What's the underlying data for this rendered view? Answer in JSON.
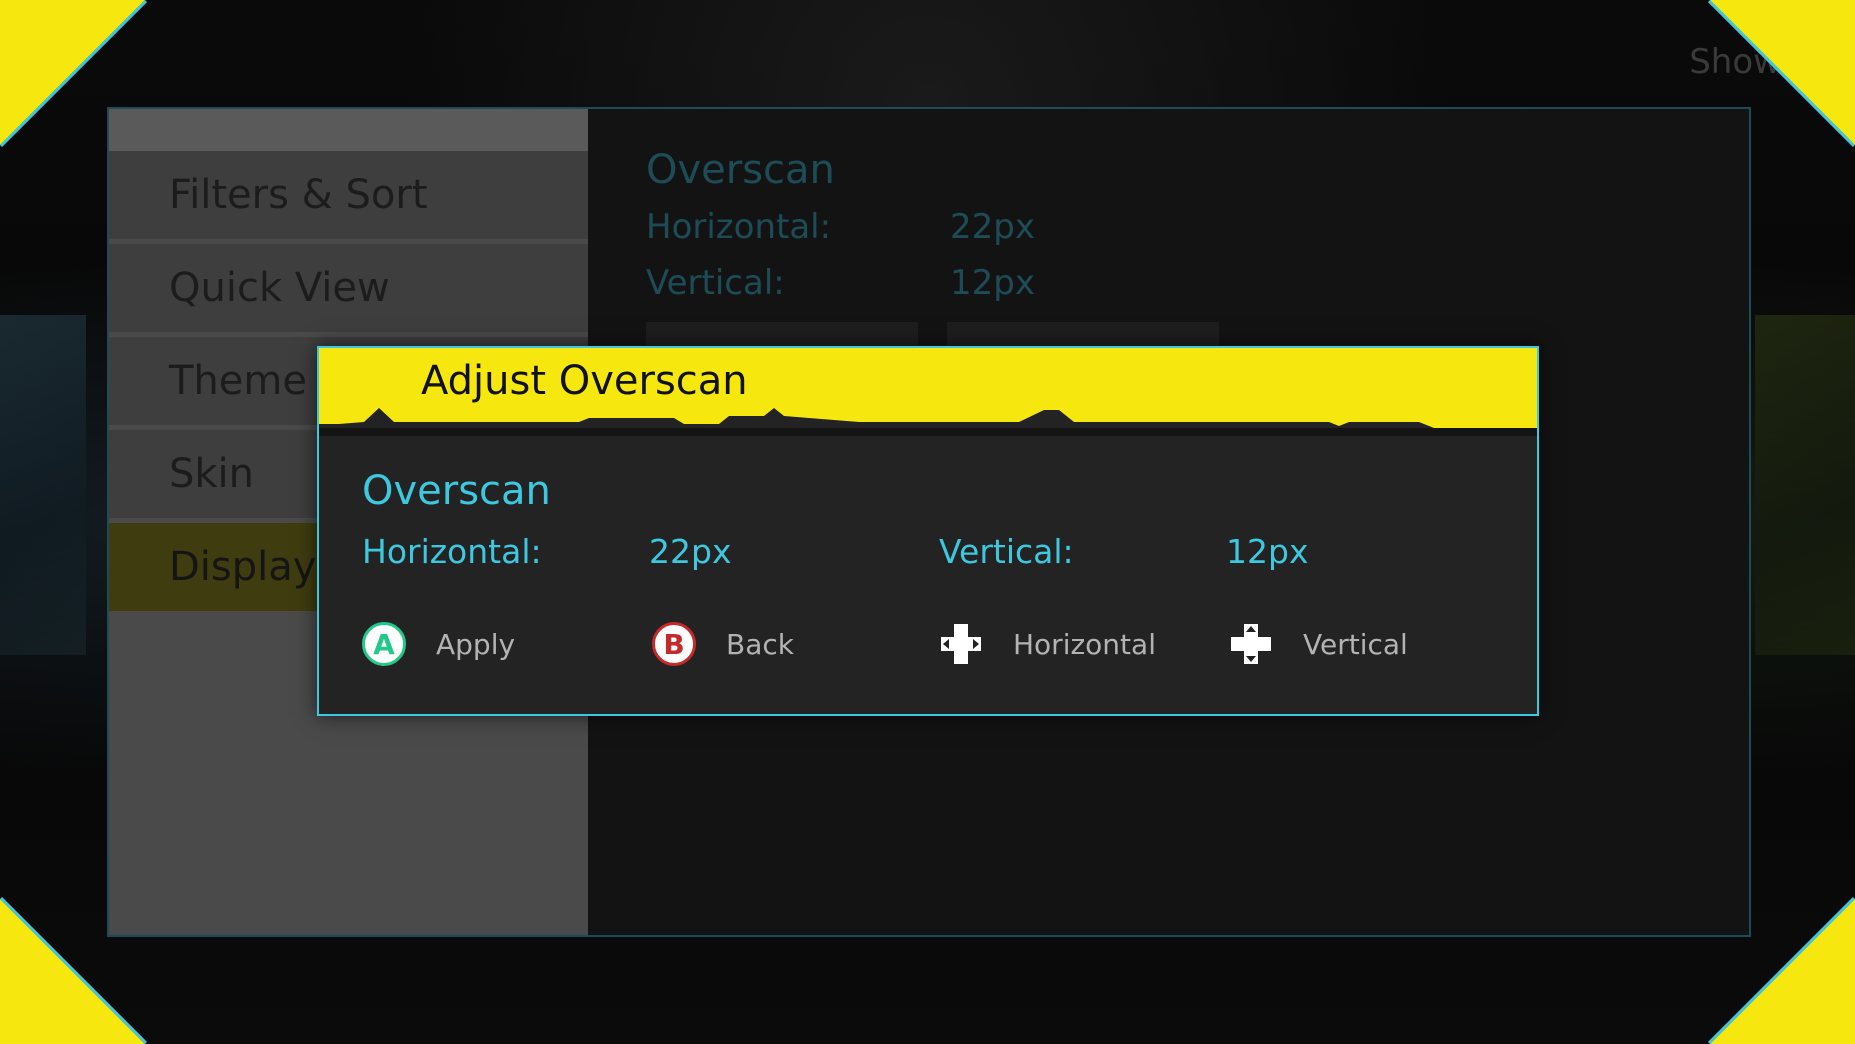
{
  "top_right_text": "Show A",
  "menu": {
    "items": [
      {
        "label": "Filters & Sort",
        "selected": false
      },
      {
        "label": "Quick View",
        "selected": false
      },
      {
        "label": "Theme",
        "selected": false
      },
      {
        "label": "Skin",
        "selected": false
      },
      {
        "label": "Display",
        "selected": true
      }
    ]
  },
  "background_content": {
    "title": "Overscan",
    "horizontal_label": "Horizontal:",
    "horizontal_value": "22px",
    "vertical_label": "Vertical:",
    "vertical_value": "12px"
  },
  "dialog": {
    "title": "Adjust Overscan",
    "section_title": "Overscan",
    "horizontal_label": "Horizontal:",
    "horizontal_value": "22px",
    "vertical_label": "Vertical:",
    "vertical_value": "12px",
    "actions": [
      {
        "button": "A",
        "label": "Apply",
        "icon": "a-button-icon"
      },
      {
        "button": "B",
        "label": "Back",
        "icon": "b-button-icon"
      },
      {
        "label": "Horizontal",
        "icon": "dpad-horizontal-icon"
      },
      {
        "label": "Vertical",
        "icon": "dpad-vertical-icon"
      }
    ]
  },
  "colors": {
    "accent_yellow": "#f6e80f",
    "accent_cyan": "#3dc8df",
    "a_green": "#24c98a",
    "b_red": "#c52a2a"
  }
}
